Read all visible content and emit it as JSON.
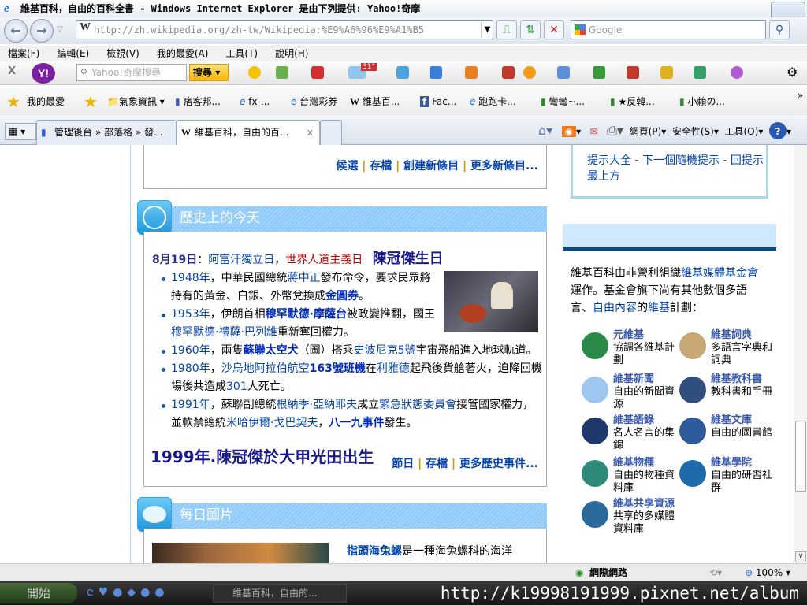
{
  "window": {
    "title": "維基百科，自由的百科全書 - Windows Internet Explorer 是由下列提供: Yahoo!奇摩"
  },
  "address": {
    "url": "http://zh.wikipedia.org/zh-tw/Wikipedia:%E9%A6%96%E9%A1%B5",
    "search_placeholder": "Google"
  },
  "menu": [
    "檔案(F)",
    "編輯(E)",
    "檢視(V)",
    "我的最愛(A)",
    "工具(T)",
    "說明(H)"
  ],
  "yahoo_toolbar": {
    "search_placeholder": "Yahoo!奇摩搜尋",
    "search_button": "搜尋",
    "weather": "31°"
  },
  "favorites": {
    "label": "我的最愛",
    "items": [
      "氣象資訊",
      "痞客邦...",
      "fx-...",
      "台灣彩券",
      "維基百...",
      "Fac...",
      "跑跑卡...",
      "彎彎~...",
      "★反韓...",
      "小賴の..."
    ]
  },
  "tabs": [
    {
      "label": "管理後台 » 部落格 » 發..."
    },
    {
      "label": "維基百科，自由的百..."
    }
  ],
  "command_bar": {
    "page": "網頁(P)",
    "safety": "安全性(S)",
    "tools": "工具(O)"
  },
  "new_articles": {
    "links": [
      "候選",
      "存檔",
      "創建新條目",
      "更多新條目..."
    ]
  },
  "tips": {
    "links": [
      "提示大全",
      "下一個隨機提示",
      "回提示最上方"
    ],
    "sep": " - "
  },
  "history": {
    "title": "歷史上的今天",
    "date": "8月19日",
    "colon": "：",
    "holiday1": "阿富汗獨立日",
    "comma": "，",
    "holiday2": "世界人道主義日",
    "overlay1": "陳冠傑生日",
    "events": [
      [
        {
          "k": "l",
          "t": "1948年"
        },
        {
          "k": "t",
          "t": "，中華民國總統"
        },
        {
          "k": "l",
          "t": "蔣中正"
        },
        {
          "k": "t",
          "t": "發布命令，要求民眾將持有的黃金、白銀、外幣兌換成"
        },
        {
          "k": "b",
          "t": "金圓券"
        },
        {
          "k": "t",
          "t": "。"
        }
      ],
      [
        {
          "k": "l",
          "t": "1953年"
        },
        {
          "k": "t",
          "t": "，伊朗首相"
        },
        {
          "k": "b",
          "t": "穆罕默德·摩薩台"
        },
        {
          "k": "t",
          "t": "被政變推翻，國王"
        },
        {
          "k": "l",
          "t": "穆罕默德·禮薩·巴列維"
        },
        {
          "k": "t",
          "t": "重新奪回權力。"
        }
      ],
      [
        {
          "k": "l",
          "t": "1960年"
        },
        {
          "k": "t",
          "t": "，兩隻"
        },
        {
          "k": "b",
          "t": "蘇聯太空犬"
        },
        {
          "k": "t",
          "t": "（圖）搭乘"
        },
        {
          "k": "l",
          "t": "史波尼克5號"
        },
        {
          "k": "t",
          "t": "宇宙飛船進入地球軌道。"
        }
      ],
      [
        {
          "k": "l",
          "t": "1980年"
        },
        {
          "k": "t",
          "t": "，"
        },
        {
          "k": "l",
          "t": "沙烏地阿拉伯航空"
        },
        {
          "k": "b",
          "t": "163號班機"
        },
        {
          "k": "t",
          "t": "在"
        },
        {
          "k": "l",
          "t": "利雅德"
        },
        {
          "k": "t",
          "t": "起飛後貨艙著火，迫降回機場後共造成"
        },
        {
          "k": "l",
          "t": "301"
        },
        {
          "k": "t",
          "t": "人死亡。"
        }
      ],
      [
        {
          "k": "l",
          "t": "1991年"
        },
        {
          "k": "t",
          "t": "，蘇聯副總統"
        },
        {
          "k": "l",
          "t": "根納季·亞納耶夫"
        },
        {
          "k": "t",
          "t": "成立"
        },
        {
          "k": "l",
          "t": "緊急狀態委員會"
        },
        {
          "k": "t",
          "t": "接管國家權力，並軟禁總統"
        },
        {
          "k": "l",
          "t": "米哈伊爾·戈巴契夫"
        },
        {
          "k": "t",
          "t": "，"
        },
        {
          "k": "b",
          "t": "八一九事件"
        },
        {
          "k": "t",
          "t": "發生。"
        }
      ]
    ],
    "overlay2": "1999年.陳冠傑於大甲光田出生",
    "links": [
      "節日",
      "存檔",
      "更多歷史事件..."
    ]
  },
  "picture": {
    "title": "每日圖片",
    "caption_link": "指頭海兔螺",
    "caption_text": "是一種海兔螺科的海洋"
  },
  "sister": {
    "intro": [
      {
        "k": "t",
        "t": "維基百科由非營利組織"
      },
      {
        "k": "l",
        "t": "維基媒體基金會"
      },
      {
        "k": "t",
        "t": "運作。基金會旗下尚有其他數個多語言、"
      },
      {
        "k": "l",
        "t": "自由內容"
      },
      {
        "k": "t",
        "t": "的"
      },
      {
        "k": "l",
        "t": "維基"
      },
      {
        "k": "t",
        "t": "計劃："
      }
    ],
    "projects": [
      {
        "name": "元維基",
        "desc": "協調各維基計劃",
        "color": "#2a8a4a"
      },
      {
        "name": "維基詞典",
        "desc": "多語言字典和詞典",
        "color": "#c8a874"
      },
      {
        "name": "維基新聞",
        "desc": "自由的新聞資源",
        "color": "#9ec6ee"
      },
      {
        "name": "維基教科書",
        "desc": "教科書和手冊",
        "color": "#2f4f7f"
      },
      {
        "name": "維基語錄",
        "desc": "名人名言的集錦",
        "color": "#1f3a6a"
      },
      {
        "name": "維基文庫",
        "desc": "自由的圖書館",
        "color": "#2d5a9a"
      },
      {
        "name": "維基物種",
        "desc": "自由的物種資料庫",
        "color": "#2f8a7a"
      },
      {
        "name": "維基學院",
        "desc": "自由的研習社群",
        "color": "#1f6aaa"
      },
      {
        "name": "維基共享資源",
        "desc": "共享的多媒體資料庫",
        "color": "#2a6a9a"
      }
    ]
  },
  "status": {
    "zone": "網際網路",
    "zoom": "100%"
  },
  "taskbar": {
    "start": "開始",
    "task": "維基百科，自由的...",
    "watermark": "http://k19998191999.pixnet.net/album"
  }
}
